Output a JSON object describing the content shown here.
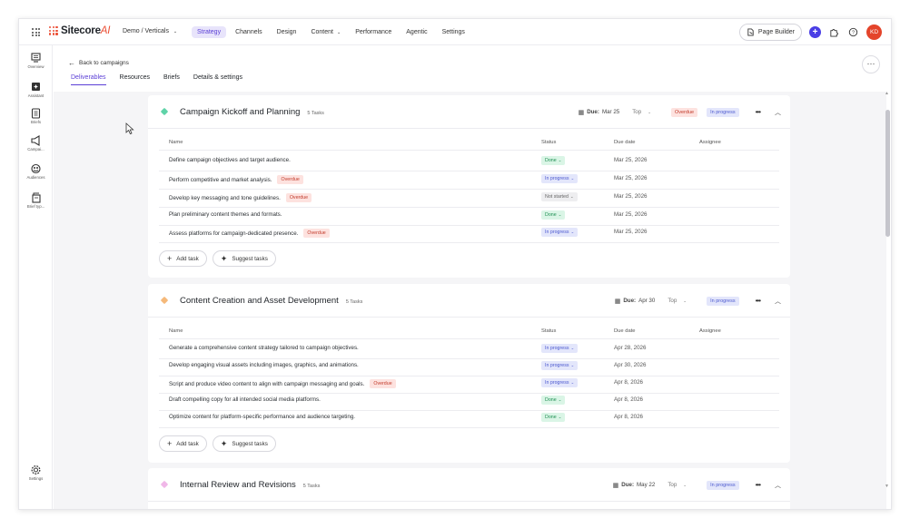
{
  "topbar": {
    "brand": "Sitecore",
    "brand_ai": "AI",
    "site_selector": "Demo / Verticals",
    "nav": [
      "Strategy",
      "Channels",
      "Design",
      "Content",
      "Performance",
      "Agentic",
      "Settings"
    ],
    "page_builder": "Page Builder",
    "avatar": "KD"
  },
  "rail": [
    {
      "icon": "overview-icon",
      "label": "Overview"
    },
    {
      "icon": "assistant-icon",
      "label": "Assistant"
    },
    {
      "icon": "briefs-icon",
      "label": "Briefs"
    },
    {
      "icon": "campaigns-icon",
      "label": "Campai..."
    },
    {
      "icon": "audiences-icon",
      "label": "Audiences"
    },
    {
      "icon": "brief-types-icon",
      "label": "Brief typ..."
    },
    {
      "icon": "settings-icon",
      "label": "Settings"
    }
  ],
  "header": {
    "back": "Back to campaigns",
    "tabs": [
      "Deliverables",
      "Resources",
      "Briefs",
      "Details & settings"
    ]
  },
  "table_headers": {
    "name": "Name",
    "status": "Status",
    "due": "Due date",
    "assignee": "Assignee"
  },
  "actions": {
    "add_task": "Add task",
    "suggest_tasks": "Suggest tasks"
  },
  "cards": [
    {
      "title": "Campaign Kickoff and Planning",
      "tasks_count": "5 Tasks",
      "due_label": "Due:",
      "due": "Mar 25",
      "priority": "Top",
      "overdue": "Overdue",
      "status": "In progress",
      "color": "#5fd3a8",
      "rows": [
        {
          "name": "Define campaign objectives and target audience.",
          "overdue": "",
          "status": "Done",
          "due": "Mar 25, 2026"
        },
        {
          "name": "Perform competitive and market analysis.",
          "overdue": "Overdue",
          "status": "In progress",
          "due": "Mar 25, 2026"
        },
        {
          "name": "Develop key messaging and tone guidelines.",
          "overdue": "Overdue",
          "status": "Not started",
          "due": "Mar 25, 2026"
        },
        {
          "name": "Plan preliminary content themes and formats.",
          "overdue": "",
          "status": "Done",
          "due": "Mar 25, 2026"
        },
        {
          "name": "Assess platforms for campaign-dedicated presence.",
          "overdue": "Overdue",
          "status": "In progress",
          "due": "Mar 25, 2026"
        }
      ]
    },
    {
      "title": "Content Creation and Asset Development",
      "tasks_count": "5 Tasks",
      "due_label": "Due:",
      "due": "Apr 30",
      "priority": "Top",
      "overdue": "",
      "status": "In progress",
      "color": "#f5b97a",
      "rows": [
        {
          "name": "Generate a comprehensive content strategy tailored to campaign objectives.",
          "overdue": "",
          "status": "In progress",
          "due": "Apr 28, 2026"
        },
        {
          "name": "Develop engaging visual assets including images, graphics, and animations.",
          "overdue": "",
          "status": "In progress",
          "due": "Apr 30, 2026"
        },
        {
          "name": "Script and produce video content to align with campaign messaging and goals.",
          "overdue": "Overdue",
          "status": "In progress",
          "due": "Apr 8, 2026"
        },
        {
          "name": "Draft compelling copy for all intended social media platforms.",
          "overdue": "",
          "status": "Done",
          "due": "Apr 8, 2026"
        },
        {
          "name": "Optimize content for platform-specific performance and audience targeting.",
          "overdue": "",
          "status": "Done",
          "due": "Apr 8, 2026"
        }
      ]
    },
    {
      "title": "Internal Review and Revisions",
      "tasks_count": "5 Tasks",
      "due_label": "Due:",
      "due": "May 22",
      "priority": "Top",
      "overdue": "",
      "status": "In progress",
      "color": "#f0b7e8",
      "rows": []
    }
  ]
}
